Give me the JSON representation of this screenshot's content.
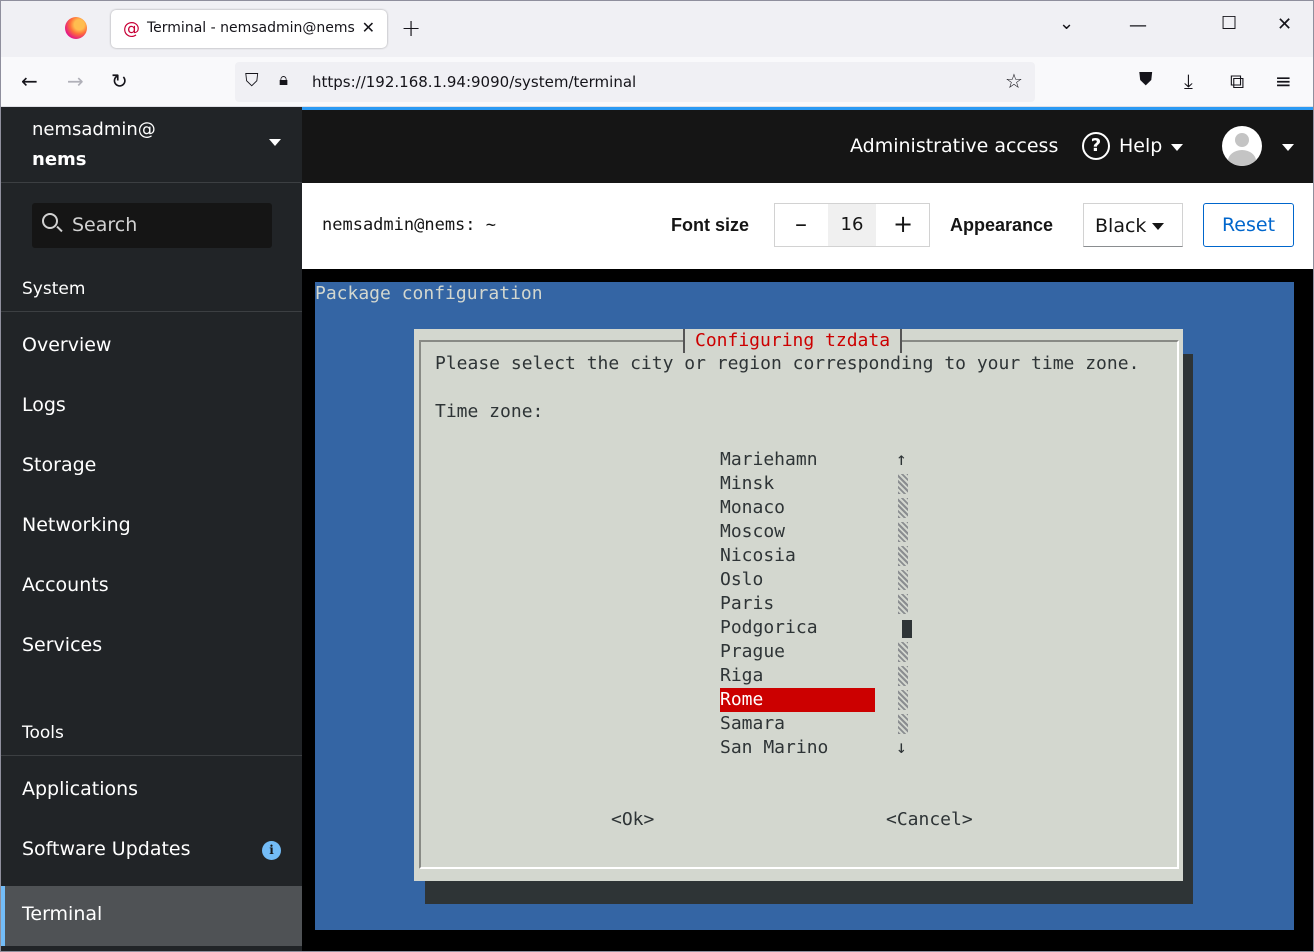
{
  "browser": {
    "tab_title": "Terminal - nemsadmin@nems",
    "url": "https://192.168.1.94:9090/system/terminal"
  },
  "sidebar": {
    "host_user": "nemsadmin@",
    "host_name": "nems",
    "search_placeholder": "Search",
    "sections": {
      "system": "System",
      "tools": "Tools"
    },
    "system_items": [
      "Overview",
      "Logs",
      "Storage",
      "Networking",
      "Accounts",
      "Services"
    ],
    "tools_items": [
      "Applications",
      "Software Updates",
      "Terminal"
    ],
    "active_item": "Terminal"
  },
  "topbar": {
    "admin_access": "Administrative access",
    "help": "Help"
  },
  "toolbar": {
    "terminal_title": "nemsadmin@nems: ~",
    "font_size_label": "Font size",
    "font_size_value": "16",
    "minus": "–",
    "plus": "+",
    "appearance_label": "Appearance",
    "appearance_value": "Black",
    "reset": "Reset"
  },
  "terminal": {
    "header": "Package configuration",
    "dialog_title": "Configuring tzdata",
    "prompt": "Please select the city or region corresponding to your time zone.",
    "field_label": "Time zone:",
    "timezones": [
      "Mariehamn",
      "Minsk",
      "Monaco",
      "Moscow",
      "Nicosia",
      "Oslo",
      "Paris",
      "Podgorica",
      "Prague",
      "Riga",
      "Rome",
      "Samara",
      "San Marino"
    ],
    "selected": "Rome",
    "arrow_up": "↑",
    "arrow_down": "↓",
    "ok": "<Ok>",
    "cancel": "<Cancel>"
  },
  "colors": {
    "terminal_bg": "#3465a4",
    "dialog_bg": "#d3d7cf",
    "highlight": "#cc0000",
    "accent": "#06c"
  }
}
